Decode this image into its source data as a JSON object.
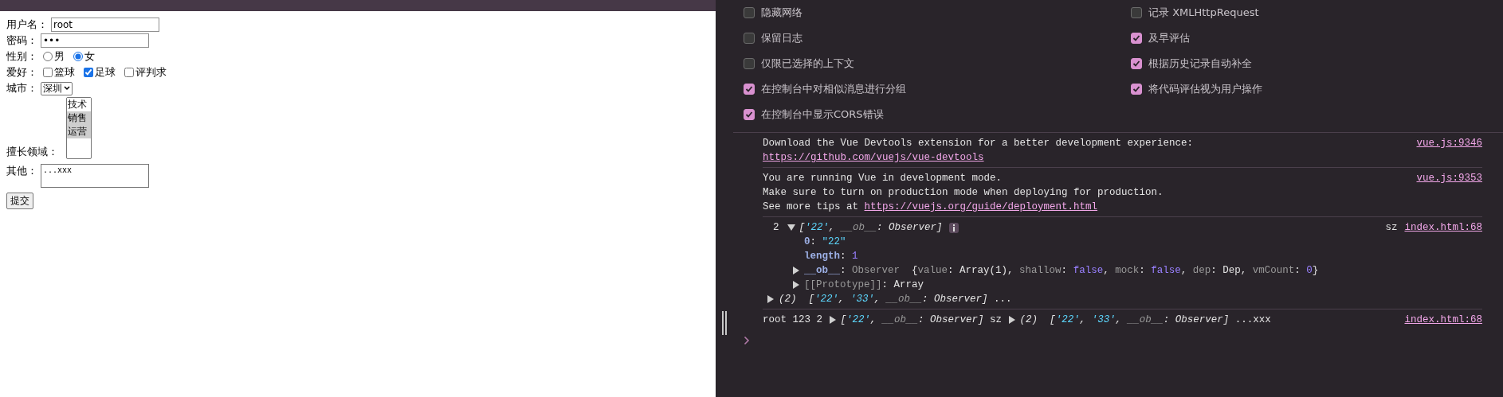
{
  "form": {
    "fields": [
      {
        "kind": "text",
        "label": "用户名：",
        "value": "root"
      },
      {
        "kind": "text",
        "label": "密码：",
        "value": "•••"
      },
      {
        "kind": "radio",
        "label": "性别：",
        "options": [
          {
            "label": "男",
            "selected": false
          },
          {
            "label": "女",
            "selected": true
          }
        ]
      },
      {
        "kind": "checkbox",
        "label": "爱好：",
        "options": [
          {
            "label": "篮球",
            "checked": false
          },
          {
            "label": "足球",
            "checked": true
          },
          {
            "label": "评判求",
            "checked": false
          }
        ]
      },
      {
        "kind": "select",
        "label": "城市：",
        "value": "深圳"
      },
      {
        "kind": "listbox",
        "label": "擅长领域：",
        "options": [
          {
            "label": "技术",
            "selected": false
          },
          {
            "label": "销售",
            "selected": true
          },
          {
            "label": "运营",
            "selected": true
          }
        ]
      },
      {
        "kind": "textarea",
        "label": "其他：",
        "value": "...xxx"
      }
    ],
    "submit": "提交"
  },
  "devtools": {
    "setting_columns": [
      [
        {
          "label": "隐藏网络",
          "checked": false
        },
        {
          "label": "保留日志",
          "checked": false
        },
        {
          "label": "仅限已选择的上下文",
          "checked": false
        },
        {
          "label": "在控制台中对相似消息进行分组",
          "checked": true
        },
        {
          "label": "在控制台中显示CORS错误",
          "checked": true
        }
      ],
      [
        {
          "label": "记录 XMLHttpRequest",
          "checked": false
        },
        {
          "label": "及早评估",
          "checked": true
        },
        {
          "label": "根据历史记录自动补全",
          "checked": true
        },
        {
          "label": "将代码评估视为用户操作",
          "checked": true
        }
      ]
    ],
    "console": [
      {
        "kind": "text",
        "source": "vue.js:9346",
        "lines": [
          [
            {
              "kind": "plain",
              "text": "Download the Vue Devtools extension for a better development experience:"
            }
          ],
          [
            {
              "kind": "link",
              "text": "https://github.com/vuejs/vue-devtools"
            }
          ]
        ]
      },
      {
        "kind": "text",
        "source": "vue.js:9353",
        "lines": [
          [
            {
              "kind": "plain",
              "text": "You are running Vue in development mode."
            }
          ],
          [
            {
              "kind": "plain",
              "text": "Make sure to turn on production mode when deploying for production."
            }
          ],
          [
            {
              "kind": "plain",
              "text": "See more tips at "
            },
            {
              "kind": "link",
              "text": "https://vuejs.org/guide/deployment.html"
            }
          ]
        ]
      },
      {
        "kind": "object",
        "count": "2",
        "context": "sz",
        "source": "index.html:68",
        "summary": [
          {
            "kind": "toggle",
            "expanded": true
          },
          {
            "kind": "ital",
            "text": "["
          },
          {
            "kind": "str",
            "text": "'22'"
          },
          {
            "kind": "ital",
            "text": ", "
          },
          {
            "kind": "dimital",
            "text": "__ob__"
          },
          {
            "kind": "ital",
            "text": ": Observer]"
          }
        ],
        "children": [
          [
            {
              "kind": "key",
              "text": "0"
            },
            {
              "kind": "plain",
              "text": ": "
            },
            {
              "kind": "strq",
              "text": "\"22\""
            }
          ],
          [
            {
              "kind": "key",
              "text": "length"
            },
            {
              "kind": "plain",
              "text": ": "
            },
            {
              "kind": "num",
              "text": "1"
            }
          ],
          [
            {
              "kind": "toggle",
              "expanded": false
            },
            {
              "kind": "key",
              "text": "__ob__"
            },
            {
              "kind": "plain",
              "text": ": "
            },
            {
              "kind": "dim",
              "text": "Observer"
            },
            {
              "kind": "plain",
              "text": "  {"
            },
            {
              "kind": "dim",
              "text": "value"
            },
            {
              "kind": "plain",
              "text": ": Array(1), "
            },
            {
              "kind": "dim",
              "text": "shallow"
            },
            {
              "kind": "plain",
              "text": ": "
            },
            {
              "kind": "num",
              "text": "false"
            },
            {
              "kind": "plain",
              "text": ", "
            },
            {
              "kind": "dim",
              "text": "mock"
            },
            {
              "kind": "plain",
              "text": ": "
            },
            {
              "kind": "num",
              "text": "false"
            },
            {
              "kind": "plain",
              "text": ", "
            },
            {
              "kind": "dim",
              "text": "dep"
            },
            {
              "kind": "plain",
              "text": ": Dep, "
            },
            {
              "kind": "dim",
              "text": "vmCount"
            },
            {
              "kind": "plain",
              "text": ": "
            },
            {
              "kind": "num",
              "text": "0"
            },
            {
              "kind": "plain",
              "text": "}"
            }
          ],
          [
            {
              "kind": "toggle",
              "expanded": false
            },
            {
              "kind": "dim",
              "text": "[[Prototype]]"
            },
            {
              "kind": "plain",
              "text": ": Array"
            }
          ]
        ],
        "trailing": [
          {
            "kind": "toggle",
            "expanded": false
          },
          {
            "kind": "ital",
            "text": "(2)  ["
          },
          {
            "kind": "str",
            "text": "'22'"
          },
          {
            "kind": "ital",
            "text": ", "
          },
          {
            "kind": "str",
            "text": "'33'"
          },
          {
            "kind": "ital",
            "text": ", "
          },
          {
            "kind": "dimital",
            "text": "__ob__"
          },
          {
            "kind": "ital",
            "text": ": Observer]"
          },
          {
            "kind": "plain",
            "text": " ..."
          }
        ]
      },
      {
        "kind": "text",
        "source": "index.html:68",
        "lines": [
          [
            {
              "kind": "plain",
              "text": "root 123 2 "
            },
            {
              "kind": "toggle",
              "expanded": false
            },
            {
              "kind": "ital",
              "text": "["
            },
            {
              "kind": "str",
              "text": "'22'"
            },
            {
              "kind": "ital",
              "text": ", "
            },
            {
              "kind": "dimital",
              "text": "__ob__"
            },
            {
              "kind": "ital",
              "text": ": Observer]"
            },
            {
              "kind": "plain",
              "text": " sz "
            },
            {
              "kind": "toggle",
              "expanded": false
            },
            {
              "kind": "ital",
              "text": "(2)  ["
            },
            {
              "kind": "str",
              "text": "'22'"
            },
            {
              "kind": "ital",
              "text": ", "
            },
            {
              "kind": "str",
              "text": "'33'"
            },
            {
              "kind": "ital",
              "text": ", "
            },
            {
              "kind": "dimital",
              "text": "__ob__"
            },
            {
              "kind": "ital",
              "text": ": Observer]"
            },
            {
              "kind": "plain",
              "text": " ...xxx"
            }
          ]
        ]
      }
    ]
  }
}
